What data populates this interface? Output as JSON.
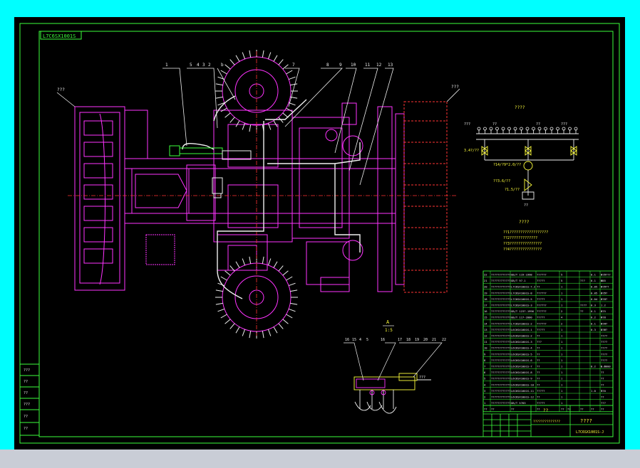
{
  "sheet": {
    "title_block_code": "L7C6SX1001S",
    "callouts_top": [
      "1",
      "5",
      "4",
      "3",
      "2",
      "b",
      "7",
      "8",
      "9",
      "10",
      "11",
      "12",
      "13"
    ],
    "left_label": "???",
    "right_label": "???",
    "section_label": "A",
    "section_sub": "1:5",
    "callouts_bottom": [
      "16",
      "15",
      "4",
      "5",
      "16",
      "17",
      "18",
      "19",
      "20",
      "21",
      "22"
    ],
    "bottom_side_label": "???"
  },
  "schematic": {
    "title": "????",
    "labels_top": [
      "???",
      "??",
      "??",
      "???"
    ],
    "label_left": "3.4?/??",
    "label_mid1": "?14/?9*2.0/??",
    "label_mid2": "??3.6/??",
    "label_mid3": "?1.5/??",
    "label_bottom": "??",
    "notes_title": "????",
    "notes": [
      "??1??????????????????",
      "??2?????????????",
      "??3???????????????",
      "??4???????????????"
    ]
  },
  "bom": {
    "rows": [
      [
        "22",
        "????????????",
        "GB/T 119-1998",
        "??????",
        "5",
        "",
        "",
        "0.1",
        "0.5",
        "??????"
      ],
      [
        "21",
        "????????????",
        "GB/T 97.1",
        "?????",
        "5",
        "",
        "???",
        "0.1",
        "0.5",
        "GB"
      ],
      [
        "20",
        "????????????",
        "L7C6SX1001S-7.2",
        "??",
        "1",
        "",
        "",
        "0.05",
        "0.5",
        "?????"
      ],
      [
        "19",
        "????????????",
        "L7C6SX1001S-8",
        "??????",
        "1",
        "",
        "",
        "0.05",
        "0.5",
        "????"
      ],
      [
        "18",
        "????????????",
        "L7C6SX1001S-5",
        "?????",
        "1",
        "",
        "",
        "0.04",
        "0.4",
        "????"
      ],
      [
        "17",
        "????????????",
        "L7C6SX1001S-3",
        "??????",
        "1",
        "",
        "????",
        "0.3",
        "1.2",
        ""
      ],
      [
        "16",
        "????????????",
        "GB/T 1237-1996",
        "??????",
        "2",
        "",
        "??",
        "0.1",
        "0.5",
        "??"
      ],
      [
        "15",
        "????????????",
        "GB/T 117-2000",
        "?????",
        "4",
        "",
        "",
        "0.2",
        "0.8",
        "??"
      ],
      [
        "14",
        "????????????",
        "L7C6SX1001S-2",
        "??????",
        "2",
        "",
        "",
        "0.1",
        "0.4",
        "????"
      ],
      [
        "13",
        "????????????",
        "L6C6SX1001S-1",
        "?????",
        "1",
        "",
        "",
        "0.3",
        "0.6",
        "????"
      ],
      [
        "12",
        "????????????",
        "L6C6SX1001S-2",
        "??",
        "1",
        "",
        "",
        "",
        "",
        "????"
      ],
      [
        "11",
        "????????????",
        "L6C6SX1001S-3",
        "???",
        "1",
        "",
        "",
        "",
        "",
        "????"
      ],
      [
        "10",
        "????????????",
        "L6C6SX1001S-4",
        "??",
        "1",
        "",
        "",
        "",
        "",
        "????"
      ],
      [
        "9",
        "????????????",
        "L6C6SX1001S-5",
        "??",
        "1",
        "",
        "",
        "",
        "",
        "????"
      ],
      [
        "8",
        "????????????",
        "L6C6SX1001S-6",
        "??",
        "1",
        "",
        "",
        "",
        "",
        "????"
      ],
      [
        "7",
        "????????????",
        "L6C6SX1001S-7",
        "??",
        "1",
        "",
        "",
        "0.2",
        "0.6",
        "L-2000"
      ],
      [
        "6",
        "????????????",
        "L6C6SX1001S-8",
        "??",
        "1",
        "",
        "",
        "",
        "",
        "??"
      ],
      [
        "5",
        "????????????",
        "L6C6SX1001S-9",
        "??",
        "1",
        "",
        "",
        "",
        "",
        "??"
      ],
      [
        "4",
        "????????????",
        "L6C6SX1001S-10",
        "??",
        "1",
        "",
        "",
        "",
        "",
        "??"
      ],
      [
        "3",
        "????????????",
        "L6C6SX1001S-11",
        "?????",
        "1",
        "",
        "",
        "1.0",
        "5.0",
        "??"
      ],
      [
        "2",
        "????????????",
        "L6C6SX1001S-12",
        "??",
        "1",
        "",
        "",
        "",
        "",
        "??"
      ],
      [
        "1",
        "????????????",
        "GB/T 5783",
        "?????",
        "1",
        "",
        "",
        "",
        "",
        "???"
      ]
    ],
    "header": [
      "??",
      "??",
      "??",
      "??",
      "??",
      "??",
      "??",
      "??",
      "??",
      "??"
    ]
  },
  "title_block": {
    "drawing_name": "??",
    "company": "????",
    "drawing_code": "L7C6SX1001S-J",
    "dept_label": "??????????????"
  },
  "side_table": [
    "???",
    "??",
    "??",
    "???",
    "??",
    "??"
  ]
}
